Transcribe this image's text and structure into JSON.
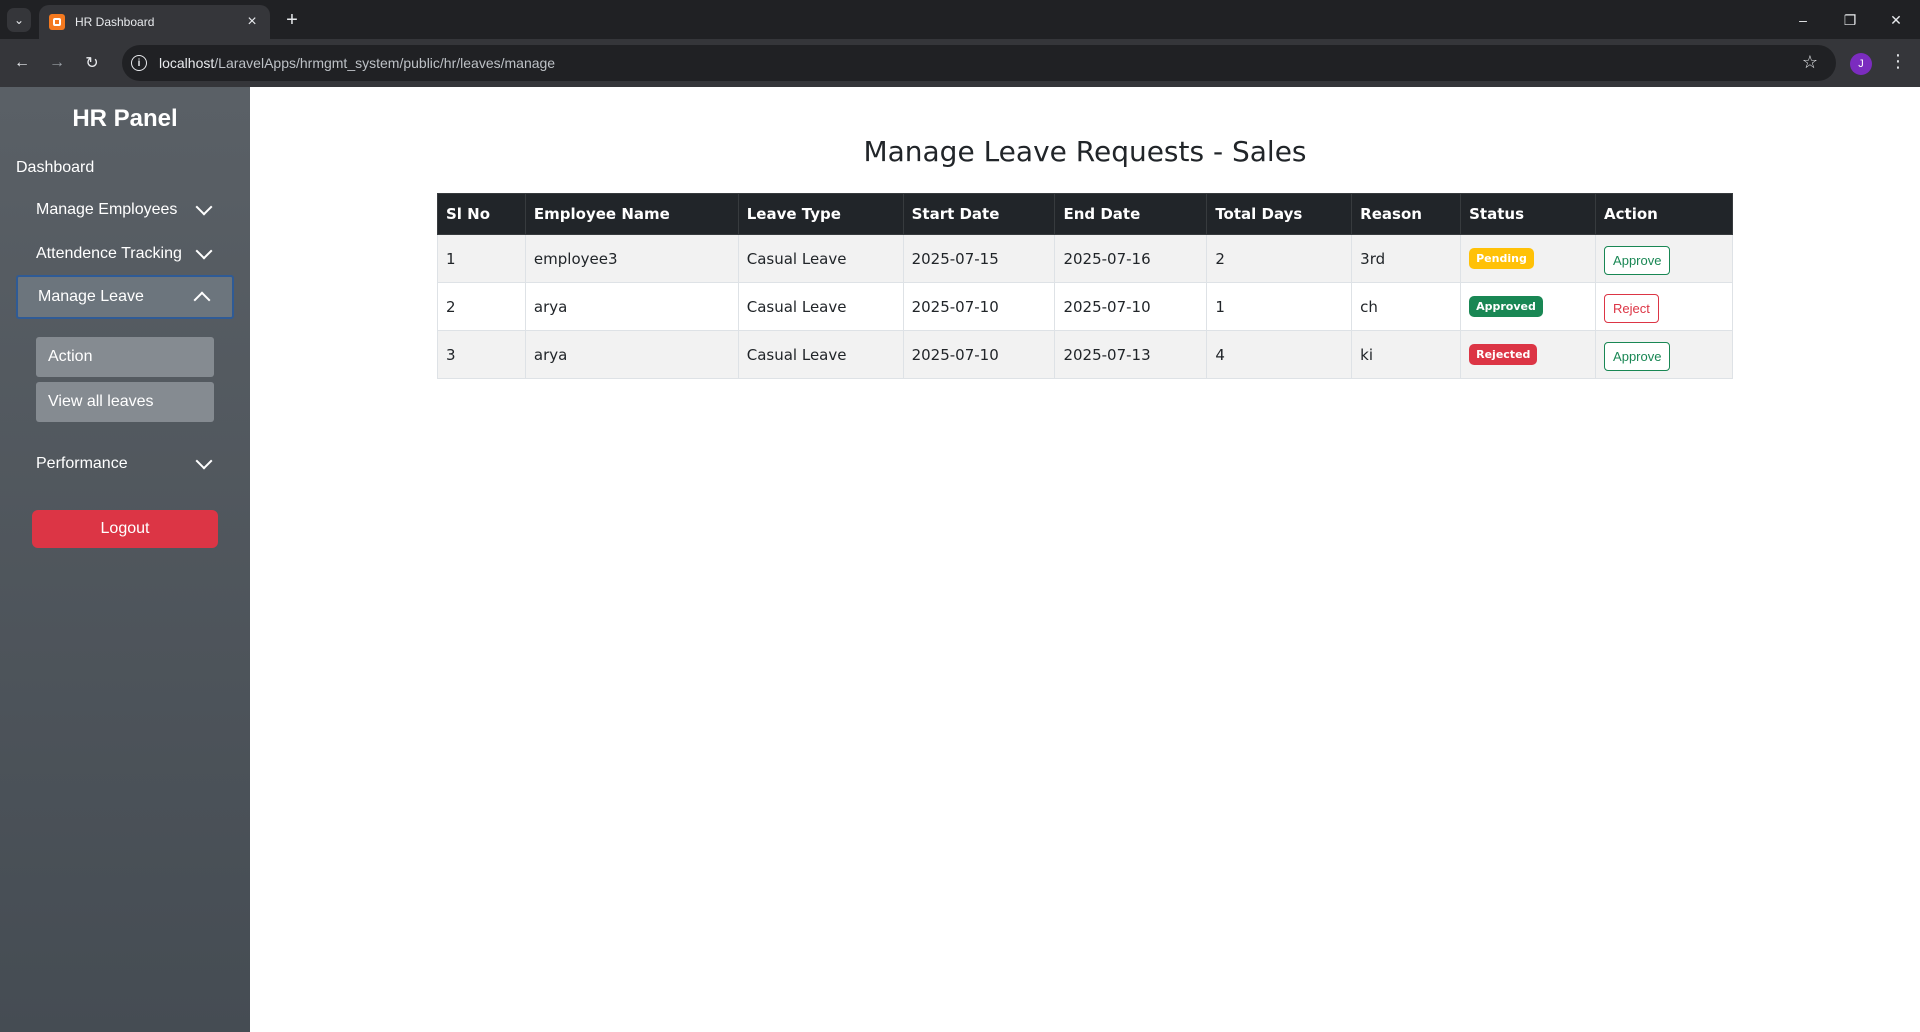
{
  "browser": {
    "tab_title": "HR Dashboard",
    "url_host": "localhost",
    "url_path": "/LaravelApps/hrmgmt_system/public/hr/leaves/manage",
    "profile_initial": "J"
  },
  "sidebar": {
    "brand": "HR Panel",
    "dashboard": "Dashboard",
    "manage_employees": "Manage Employees",
    "attendance_tracking": "Attendence Tracking",
    "manage_leave": "Manage Leave",
    "sub_items": [
      "Action",
      "View all leaves"
    ],
    "performance": "Performance",
    "logout": "Logout"
  },
  "main": {
    "title": "Manage Leave Requests - Sales",
    "columns": [
      "Sl No",
      "Employee Name",
      "Leave Type",
      "Start Date",
      "End Date",
      "Total Days",
      "Reason",
      "Status",
      "Action"
    ],
    "rows": [
      {
        "sl": "1",
        "name": "employee3",
        "type": "Casual Leave",
        "start": "2025-07-15",
        "end": "2025-07-16",
        "days": "2",
        "reason": "3rd",
        "status": "Pending",
        "action": "Approve"
      },
      {
        "sl": "2",
        "name": "arya",
        "type": "Casual Leave",
        "start": "2025-07-10",
        "end": "2025-07-10",
        "days": "1",
        "reason": "ch",
        "status": "Approved",
        "action": "Reject"
      },
      {
        "sl": "3",
        "name": "arya",
        "type": "Casual Leave",
        "start": "2025-07-10",
        "end": "2025-07-13",
        "days": "4",
        "reason": "ki",
        "status": "Rejected",
        "action": "Approve"
      }
    ]
  },
  "colors": {
    "sidebar_bg": "#50575e",
    "logout_red": "#dc3545",
    "pending": "#ffc107",
    "approved": "#198754",
    "rejected": "#dc3545",
    "table_header": "#212529"
  }
}
